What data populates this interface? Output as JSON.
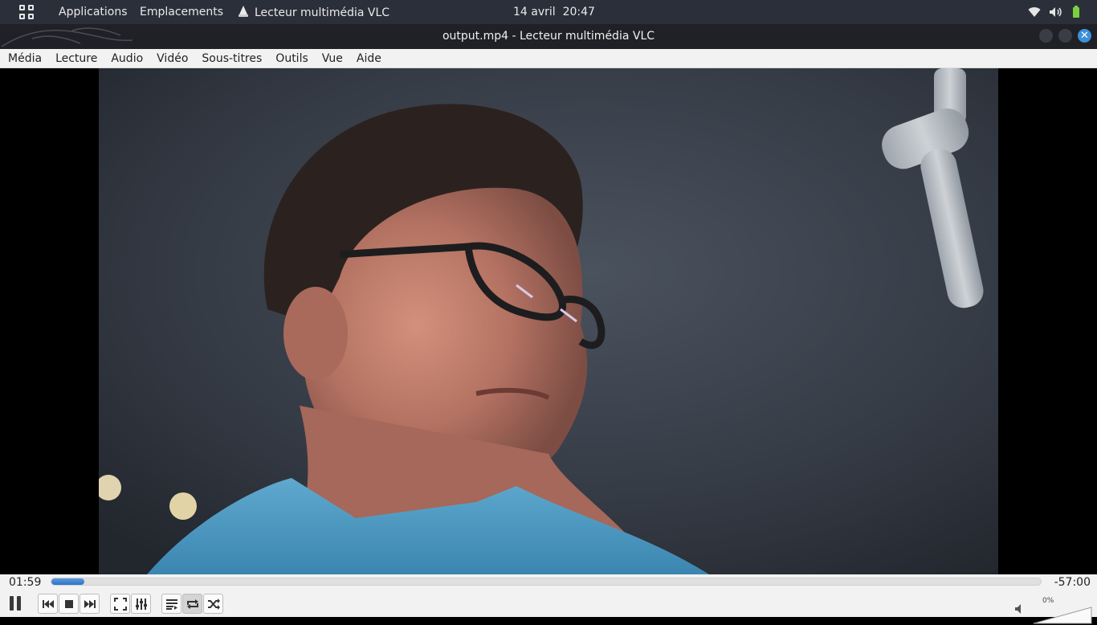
{
  "panel": {
    "applications": "Applications",
    "places": "Emplacements",
    "active_app": "Lecteur multimédia VLC",
    "date": "14 avril",
    "time": "20:47",
    "tray_icons": [
      "wifi-icon",
      "volume-icon",
      "battery-icon"
    ]
  },
  "window": {
    "title": "output.mp4 - Lecteur multimédia VLC"
  },
  "menu": {
    "items": [
      {
        "label": "Média"
      },
      {
        "label": "Lecture"
      },
      {
        "label": "Audio"
      },
      {
        "label": "Vidéo"
      },
      {
        "label": "Sous-titres"
      },
      {
        "label": "Outils"
      },
      {
        "label": "Vue"
      },
      {
        "label": "Aide"
      }
    ]
  },
  "player": {
    "elapsed": "01:59",
    "remaining": "-57:00",
    "progress_fraction": 0.033,
    "volume_label": "0%",
    "volume_fraction": 0.0,
    "accent_color": "#2f74c4"
  },
  "controls": {
    "buttons": [
      "pause-icon",
      "previous-icon",
      "stop-icon",
      "next-icon",
      "fullscreen-icon",
      "extended-settings-icon",
      "playlist-icon",
      "loop-icon",
      "shuffle-icon"
    ]
  }
}
